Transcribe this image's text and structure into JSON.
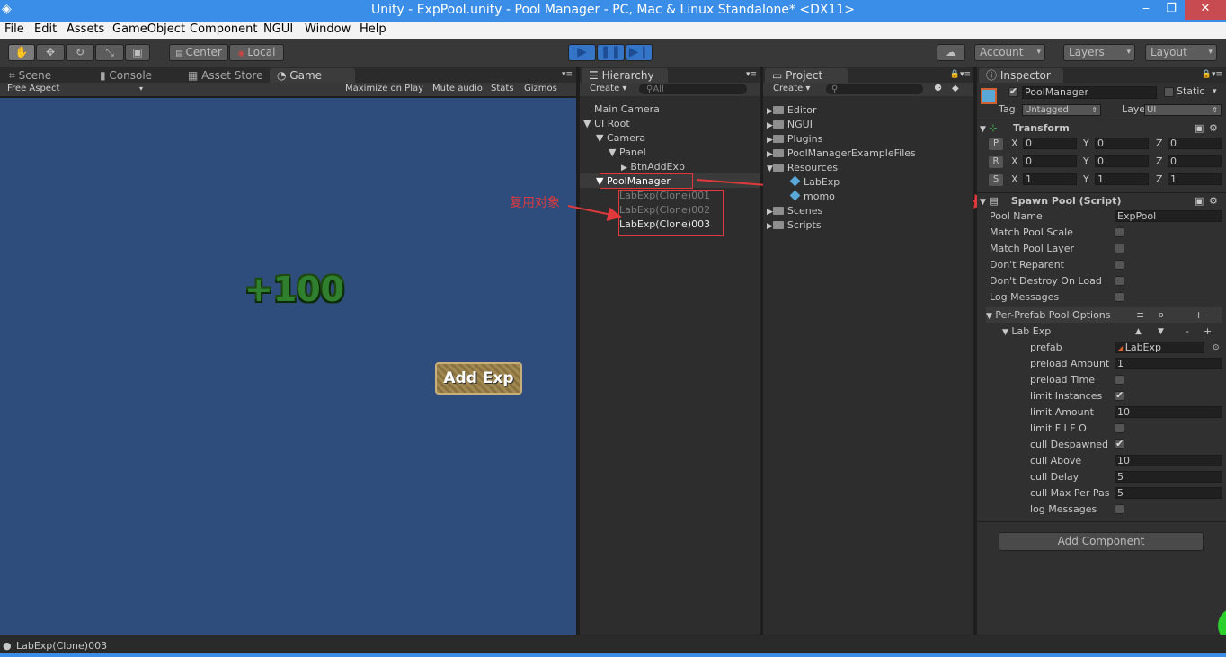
{
  "window": {
    "title": "Unity - ExpPool.unity - Pool Manager - PC, Mac & Linux Standalone* <DX11>",
    "min": "‒",
    "max": "❐",
    "close": "✕"
  },
  "menu": [
    "File",
    "Edit",
    "Assets",
    "GameObject",
    "Component",
    "NGUI",
    "Window",
    "Help"
  ],
  "toolbar": {
    "center": "Center",
    "local": "Local",
    "account": "Account",
    "layers": "Layers",
    "layout": "Layout"
  },
  "tabs": {
    "scene": "Scene",
    "console": "Console",
    "asset_store": "Asset Store",
    "game": "Game",
    "hierarchy": "Hierarchy",
    "project": "Project",
    "inspector": "Inspector"
  },
  "game_bar": {
    "aspect": "Free Aspect",
    "maximize": "Maximize on Play",
    "mute": "Mute audio",
    "stats": "Stats",
    "gizmos": "Gizmos"
  },
  "game": {
    "score": "+100",
    "button": "Add Exp"
  },
  "hierarchy": {
    "create": "Create",
    "search_placeholder": "All",
    "items": [
      "Main Camera",
      "UI Root",
      "Camera",
      "Panel",
      "BtnAddExp",
      "PoolManager",
      "LabExp(Clone)001",
      "LabExp(Clone)002",
      "LabExp(Clone)003"
    ]
  },
  "annotation": "复用对象",
  "project": {
    "create": "Create",
    "items": [
      "Editor",
      "NGUI",
      "Plugins",
      "PoolManagerExampleFiles",
      "Resources",
      "LabExp",
      "momo",
      "Scenes",
      "Scripts"
    ]
  },
  "inspector": {
    "object_name": "PoolManager",
    "static": "Static",
    "tag_label": "Tag",
    "tag": "Untagged",
    "layer_label": "Layer",
    "layer": "UI",
    "transform": {
      "title": "Transform",
      "rows": [
        {
          "key": "P",
          "x": "0",
          "y": "0",
          "z": "0"
        },
        {
          "key": "R",
          "x": "0",
          "y": "0",
          "z": "0"
        },
        {
          "key": "S",
          "x": "1",
          "y": "1",
          "z": "1"
        }
      ],
      "axis": [
        "X",
        "Y",
        "Z"
      ]
    },
    "script": {
      "title": "Spawn Pool (Script)",
      "pool_name_label": "Pool Name",
      "pool_name": "ExpPool",
      "checks": [
        {
          "label": "Match Pool Scale",
          "on": false
        },
        {
          "label": "Match Pool Layer",
          "on": false
        },
        {
          "label": "Don't Reparent",
          "on": false
        },
        {
          "label": "Don't Destroy On Load",
          "on": false
        },
        {
          "label": "Log Messages",
          "on": false
        }
      ],
      "per_prefab": "Per-Prefab Pool Options",
      "lab_exp": "Lab Exp",
      "prefab_label": "prefab",
      "prefab": "LabExp",
      "props": [
        {
          "label": "preload Amount",
          "value": "1",
          "type": "field"
        },
        {
          "label": "preload Time",
          "value": false,
          "type": "check"
        },
        {
          "label": "limit Instances",
          "value": true,
          "type": "check"
        },
        {
          "label": "limit Amount",
          "value": "10",
          "type": "field"
        },
        {
          "label": "limit F I F O",
          "value": false,
          "type": "check"
        },
        {
          "label": "cull Despawned",
          "value": true,
          "type": "check"
        },
        {
          "label": "cull Above",
          "value": "10",
          "type": "field"
        },
        {
          "label": "cull Delay",
          "value": "5",
          "type": "field"
        },
        {
          "label": "cull Max Per Pas",
          "value": "5",
          "type": "field"
        },
        {
          "label": "log Messages",
          "value": false,
          "type": "check"
        }
      ]
    },
    "add_component": "Add Component"
  },
  "status": "LabExp(Clone)003",
  "colors": {
    "titlebar": "#3b8ee8",
    "game_bg": "#2e4c7c",
    "annotation": "#e0393c",
    "play": "#3575c8"
  }
}
